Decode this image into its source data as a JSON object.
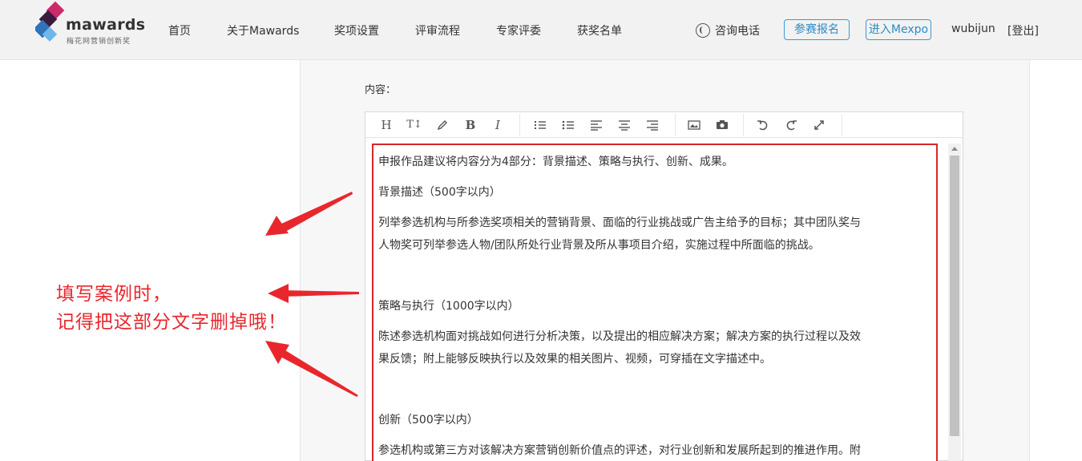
{
  "header": {
    "logo": {
      "name": "mawards",
      "subtitle": "梅花网营销创新奖",
      "colors": [
        "#cc2a6a",
        "#3b1b3d",
        "#2f73b8",
        "#6db7e9"
      ]
    },
    "nav": [
      {
        "label": "首页"
      },
      {
        "label": "关于Mawards"
      },
      {
        "label": "奖项设置"
      },
      {
        "label": "评审流程"
      },
      {
        "label": "专家评委"
      },
      {
        "label": "获奖名单"
      }
    ],
    "phone_label": "咨询电话",
    "signup_label": "参赛报名",
    "mexpo_label": "进入Mexpo",
    "username": "wubijun",
    "logout_label": "[登出]"
  },
  "form": {
    "content_label": "内容："
  },
  "editor": {
    "toolbar": [
      {
        "name": "heading-icon",
        "glyph": "H"
      },
      {
        "name": "font-size-icon",
        "glyph": "TI"
      },
      {
        "name": "pen-icon",
        "glyph": "pen"
      },
      {
        "name": "bold-icon",
        "glyph": "B"
      },
      {
        "name": "italic-icon",
        "glyph": "I"
      },
      {
        "name": "ordered-list-icon",
        "glyph": "ol"
      },
      {
        "name": "unordered-list-icon",
        "glyph": "ul"
      },
      {
        "name": "align-left-icon",
        "glyph": "al"
      },
      {
        "name": "align-center-icon",
        "glyph": "ac"
      },
      {
        "name": "align-right-icon",
        "glyph": "ar"
      },
      {
        "name": "image-icon",
        "glyph": "img"
      },
      {
        "name": "video-icon",
        "glyph": "vid"
      },
      {
        "name": "undo-icon",
        "glyph": "undo"
      },
      {
        "name": "redo-icon",
        "glyph": "redo"
      },
      {
        "name": "fullscreen-icon",
        "glyph": "full"
      }
    ],
    "paragraphs": [
      "申报作品建议将内容分为4部分：背景描述、策略与执行、创新、成果。",
      "背景描述（500字以内）",
      "列举参选机构与所参选奖项相关的营销背景、面临的行业挑战或广告主给予的目标；其中团队奖与",
      "人物奖可列举参选人物/团队所处行业背景及所从事项目介绍，实施过程中所面临的挑战。",
      "策略与执行（1000字以内）",
      "陈述参选机构面对挑战如何进行分析决策，以及提出的相应解决方案；解决方案的执行过程以及效",
      "果反馈；附上能够反映执行以及效果的相关图片、视频，可穿插在文字描述中。",
      "创新（500字以内）",
      "参选机构或第三方对该解决方案营销创新价值点的评述，对行业创新和发展所起到的推进作用。附"
    ],
    "highlight_color": "#d9252b"
  },
  "annotation": {
    "line1": "填写案例时，",
    "line2": "记得把这部分文字删掉哦！",
    "color": "#e8272d"
  }
}
